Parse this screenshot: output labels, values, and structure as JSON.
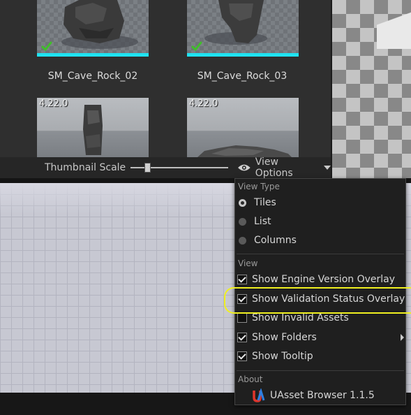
{
  "assets": [
    {
      "name": "SM_Cave_Rock_02",
      "validated": true
    },
    {
      "name": "SM_Cave_Rock_03",
      "validated": true
    },
    {
      "version": "4.22.0"
    },
    {
      "version": "4.22.0"
    }
  ],
  "thumbnail_scale": {
    "label": "Thumbnail Scale",
    "value": 0.17
  },
  "view_options": {
    "label": "View Options",
    "icon": "eye-icon"
  },
  "menu": {
    "view_type_header": "View Type",
    "view_types": [
      {
        "label": "Tiles",
        "selected": true
      },
      {
        "label": "List",
        "selected": false
      },
      {
        "label": "Columns",
        "selected": false
      }
    ],
    "view_header": "View",
    "view_items": [
      {
        "label": "Show Engine Version Overlay",
        "checked": true
      },
      {
        "label": "Show Validation Status Overlay",
        "checked": true
      },
      {
        "label": "Show Invalid Assets",
        "checked": false
      },
      {
        "label": "Show Folders",
        "checked": true,
        "submenu": true
      },
      {
        "label": "Show Tooltip",
        "checked": true
      }
    ],
    "about_header": "About",
    "about_item": "UAsset Browser 1.1.5"
  },
  "colors": {
    "validation_bar": "#1fe3f2",
    "highlight": "#f0f020",
    "check_green": "#3fbf2a"
  }
}
